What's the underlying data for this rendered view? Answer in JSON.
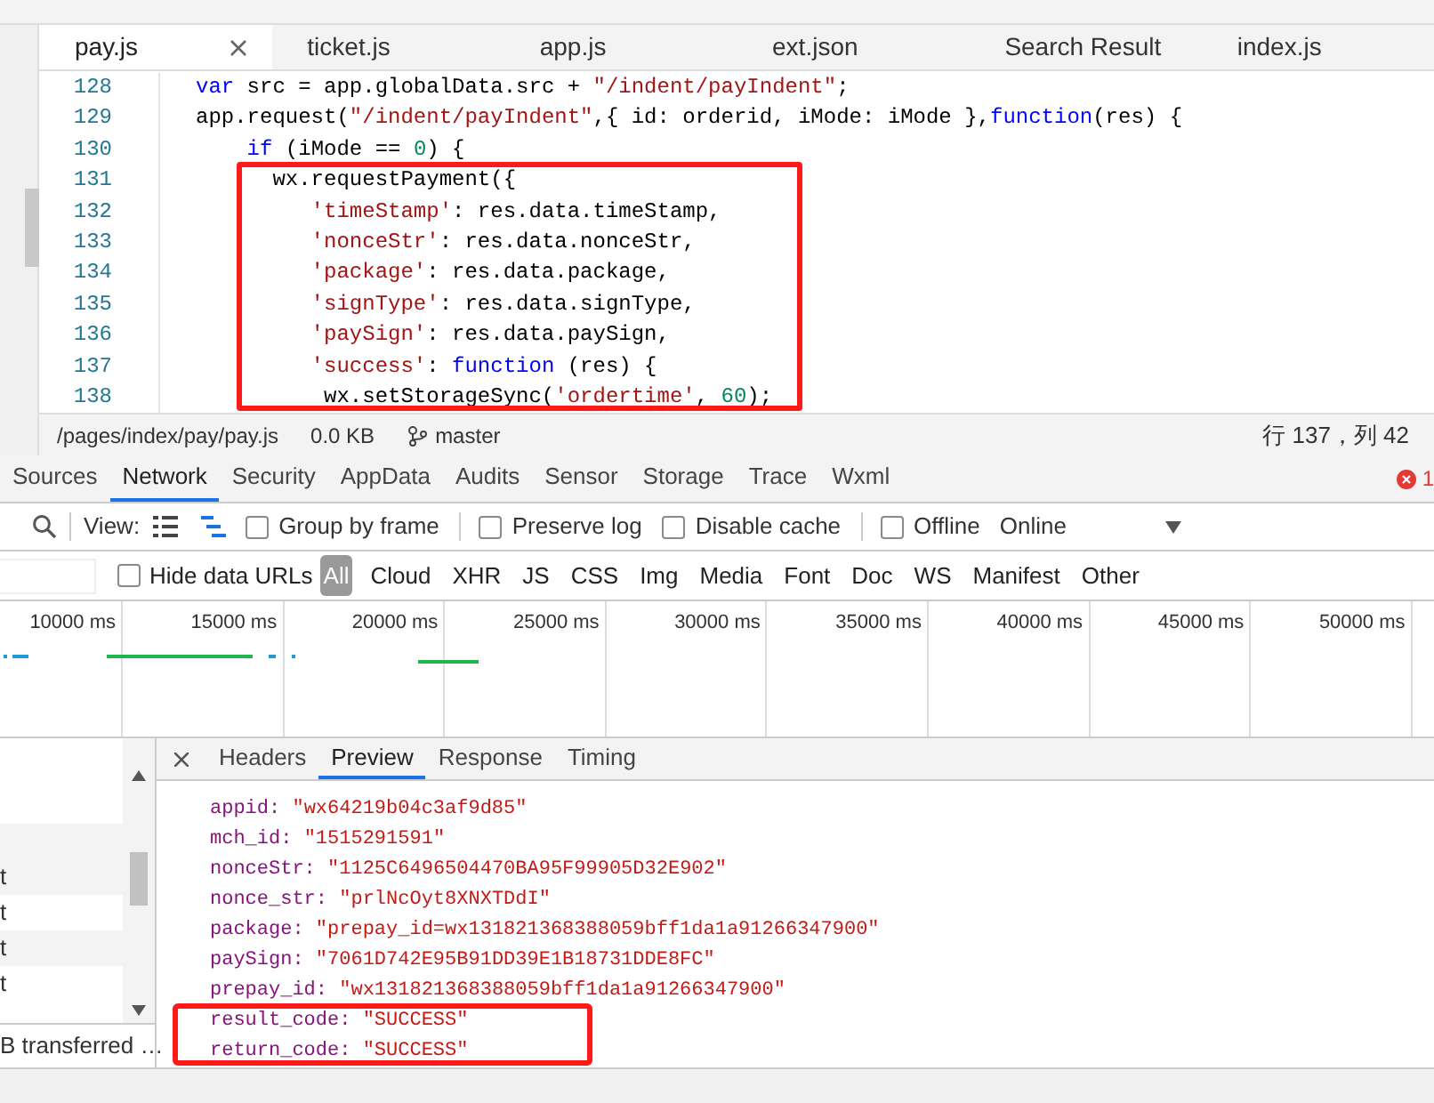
{
  "editor_tabs": [
    {
      "label": "pay.js",
      "selected": true
    },
    {
      "label": "ticket.js",
      "selected": false
    },
    {
      "label": "app.js",
      "selected": false
    },
    {
      "label": "ext.json",
      "selected": false
    },
    {
      "label": "Search Result",
      "selected": false
    },
    {
      "label": "index.js",
      "selected": false
    }
  ],
  "code_lines": [
    {
      "number": "128",
      "tokens": [
        {
          "kind": "keyword",
          "text": "var"
        },
        {
          "kind": "plain",
          "text": " src = app.globalData.src + "
        },
        {
          "kind": "string",
          "text": "\"/indent/payIndent\""
        },
        {
          "kind": "plain",
          "text": ";"
        }
      ]
    },
    {
      "number": "129",
      "tokens": [
        {
          "kind": "plain",
          "text": "app.request("
        },
        {
          "kind": "string",
          "text": "\"/indent/payIndent\""
        },
        {
          "kind": "plain",
          "text": ",{ id: orderid, iMode: iMode },"
        },
        {
          "kind": "keyword",
          "text": "function"
        },
        {
          "kind": "plain",
          "text": "(res) {"
        }
      ]
    },
    {
      "number": "130",
      "tokens": [
        {
          "kind": "keyword",
          "text": "    if"
        },
        {
          "kind": "plain",
          "text": " (iMode == "
        },
        {
          "kind": "number",
          "text": "0"
        },
        {
          "kind": "plain",
          "text": ") {"
        }
      ]
    },
    {
      "number": "131",
      "tokens": [
        {
          "kind": "plain",
          "text": "      wx.requestPayment({"
        }
      ]
    },
    {
      "number": "132",
      "tokens": [
        {
          "kind": "string",
          "text": "         'timeStamp'"
        },
        {
          "kind": "plain",
          "text": ": res.data.timeStamp,"
        }
      ]
    },
    {
      "number": "133",
      "tokens": [
        {
          "kind": "string",
          "text": "         'nonceStr'"
        },
        {
          "kind": "plain",
          "text": ": res.data.nonceStr,"
        }
      ]
    },
    {
      "number": "134",
      "tokens": [
        {
          "kind": "string",
          "text": "         'package'"
        },
        {
          "kind": "plain",
          "text": ": res.data.package,"
        }
      ]
    },
    {
      "number": "135",
      "tokens": [
        {
          "kind": "string",
          "text": "         'signType'"
        },
        {
          "kind": "plain",
          "text": ": res.data.signType,"
        }
      ]
    },
    {
      "number": "136",
      "tokens": [
        {
          "kind": "string",
          "text": "         'paySign'"
        },
        {
          "kind": "plain",
          "text": ": res.data.paySign,"
        }
      ]
    },
    {
      "number": "137",
      "tokens": [
        {
          "kind": "string",
          "text": "         'success'"
        },
        {
          "kind": "plain",
          "text": ": "
        },
        {
          "kind": "keyword",
          "text": "function"
        },
        {
          "kind": "plain",
          "text": " (res) {"
        }
      ]
    },
    {
      "number": "138",
      "tokens": [
        {
          "kind": "plain",
          "text": "          wx.setStorageSync("
        },
        {
          "kind": "string",
          "text": "'ordertime'"
        },
        {
          "kind": "plain",
          "text": ", "
        },
        {
          "kind": "number",
          "text": "60"
        },
        {
          "kind": "plain",
          "text": ");"
        }
      ]
    }
  ],
  "status_bar": {
    "path": "/pages/index/pay/pay.js",
    "size": "0.0 KB",
    "branch": "master",
    "position": "行 137，列 42"
  },
  "devtools_tabs": [
    {
      "label": "Sources",
      "selected": false
    },
    {
      "label": "Network",
      "selected": true
    },
    {
      "label": "Security",
      "selected": false
    },
    {
      "label": "AppData",
      "selected": false
    },
    {
      "label": "Audits",
      "selected": false
    },
    {
      "label": "Sensor",
      "selected": false
    },
    {
      "label": "Storage",
      "selected": false
    },
    {
      "label": "Trace",
      "selected": false
    },
    {
      "label": "Wxml",
      "selected": false
    }
  ],
  "error_count": "1",
  "toolbar": {
    "view_label": "View:",
    "checkboxes": [
      {
        "label": "Group by frame",
        "checked": false
      },
      {
        "label": "Preserve log",
        "checked": false
      },
      {
        "label": "Disable cache",
        "checked": false
      },
      {
        "label": "Offline",
        "checked": false
      }
    ],
    "throttle": "Online"
  },
  "filter_bar": {
    "hide_data_urls": {
      "label": "Hide data URLs",
      "checked": false
    },
    "types": [
      {
        "label": "All",
        "selected": true
      },
      {
        "label": "Cloud",
        "selected": false
      },
      {
        "label": "XHR",
        "selected": false
      },
      {
        "label": "JS",
        "selected": false
      },
      {
        "label": "CSS",
        "selected": false
      },
      {
        "label": "Img",
        "selected": false
      },
      {
        "label": "Media",
        "selected": false
      },
      {
        "label": "Font",
        "selected": false
      },
      {
        "label": "Doc",
        "selected": false
      },
      {
        "label": "WS",
        "selected": false
      },
      {
        "label": "Manifest",
        "selected": false
      },
      {
        "label": "Other",
        "selected": false
      }
    ]
  },
  "timeline_ticks": [
    "10000 ms",
    "15000 ms",
    "20000 ms",
    "25000 ms",
    "30000 ms",
    "35000 ms",
    "40000 ms",
    "45000 ms",
    "50000 ms"
  ],
  "request_rows": [
    "t",
    "t",
    "t",
    "t"
  ],
  "transfer_summary": "B transferred …",
  "detail_tabs": [
    {
      "label": "Headers",
      "selected": false
    },
    {
      "label": "Preview",
      "selected": true
    },
    {
      "label": "Response",
      "selected": false
    },
    {
      "label": "Timing",
      "selected": false
    }
  ],
  "preview": [
    {
      "key": "appid:",
      "value": "\"wx64219b04c3af9d85\""
    },
    {
      "key": "mch_id:",
      "value": "\"1515291591\""
    },
    {
      "key": "nonceStr:",
      "value": "\"1125C6496504470BA95F99905D32E902\""
    },
    {
      "key": "nonce_str:",
      "value": "\"prlNcOyt8XNXTDdI\""
    },
    {
      "key": "package:",
      "value": "\"prepay_id=wx131821368388059bff1da1a91266347900\""
    },
    {
      "key": "paySign:",
      "value": "\"7061D742E95B91DD39E1B18731DDE8FC\""
    },
    {
      "key": "prepay_id:",
      "value": "\"wx131821368388059bff1da1a91266347900\""
    },
    {
      "key": "result_code:",
      "value": "\"SUCCESS\""
    },
    {
      "key": "return_code:",
      "value": "\"SUCCESS\""
    }
  ]
}
